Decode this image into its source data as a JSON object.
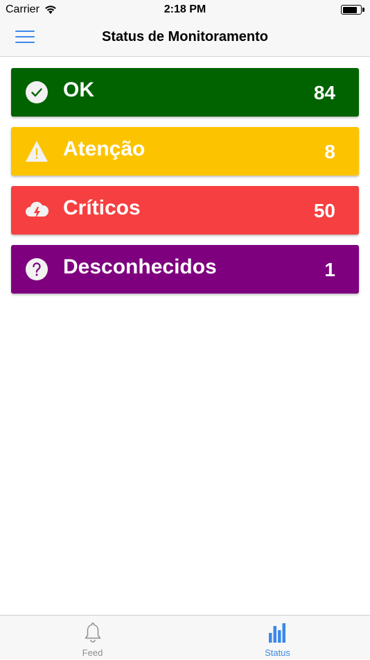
{
  "status_bar": {
    "carrier": "Carrier",
    "time": "2:18 PM"
  },
  "header": {
    "title": "Status de Monitoramento"
  },
  "cards": [
    {
      "label": "OK",
      "count": "84",
      "color": "#016300",
      "icon": "check-circle-icon"
    },
    {
      "label": "Atenção",
      "count": "8",
      "color": "#fcc400",
      "icon": "warning-triangle-icon"
    },
    {
      "label": "Críticos",
      "count": "50",
      "color": "#f63f40",
      "icon": "storm-cloud-icon"
    },
    {
      "label": "Desconhecidos",
      "count": "1",
      "color": "#7f007f",
      "icon": "question-circle-icon"
    }
  ],
  "tabs": [
    {
      "label": "Feed",
      "icon": "bell-icon",
      "color": "#8e8e93"
    },
    {
      "label": "Status",
      "icon": "bar-chart-icon",
      "color": "#3b88e8"
    }
  ]
}
